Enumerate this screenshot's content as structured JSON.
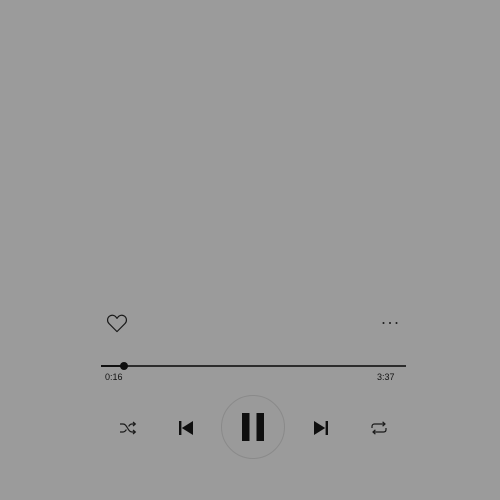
{
  "colors": {
    "background": "#9b9b9b",
    "foreground": "#111111",
    "play_button_border": "#8a8a8a"
  },
  "player": {
    "elapsed": "0:16",
    "duration": "3:37",
    "progress_fraction": 0.074,
    "is_liked": false,
    "is_playing": true
  },
  "icons": {
    "like": "heart-outline-icon",
    "more": "ellipsis-icon",
    "shuffle": "shuffle-icon",
    "previous": "skip-previous-icon",
    "play_pause": "pause-icon",
    "next": "skip-next-icon",
    "repeat": "repeat-icon"
  }
}
